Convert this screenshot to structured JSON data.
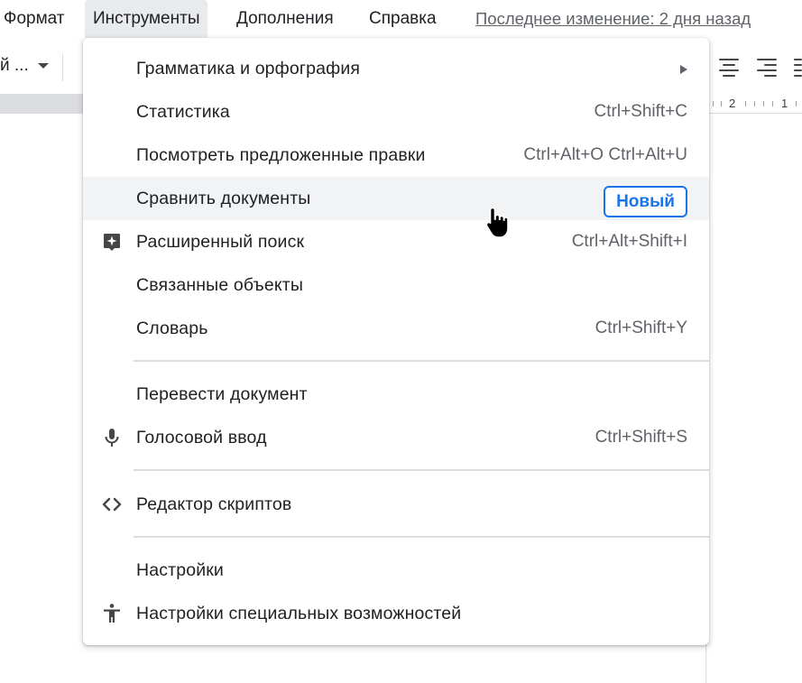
{
  "menubar": {
    "items": [
      {
        "label": "Формат"
      },
      {
        "label": "Инструменты",
        "active": true
      },
      {
        "label": "Дополнения"
      },
      {
        "label": "Справка"
      }
    ],
    "last_edit": "Последнее изменение: 2 дня назад"
  },
  "toolbar": {
    "font_fragment": "й ...",
    "icons": [
      "dropdown-caret",
      "align-center-icon",
      "align-right-icon",
      "align-justify-icon"
    ]
  },
  "ruler": {
    "numbers": [
      "2",
      "1"
    ]
  },
  "tools_menu": {
    "items": [
      {
        "label": "Грамматика и орфография",
        "submenu": true
      },
      {
        "label": "Статистика",
        "shortcut": "Ctrl+Shift+C"
      },
      {
        "label": "Посмотреть предложенные правки",
        "shortcut": "Ctrl+Alt+O Ctrl+Alt+U"
      },
      {
        "label": "Сравнить документы",
        "badge": "Новый",
        "hovered": true
      },
      {
        "label": "Расширенный поиск",
        "shortcut": "Ctrl+Alt+Shift+I",
        "icon": "sparkle-search-icon"
      },
      {
        "label": "Связанные объекты"
      },
      {
        "label": "Словарь",
        "shortcut": "Ctrl+Shift+Y"
      },
      {
        "label": "Перевести документ"
      },
      {
        "label": "Голосовой ввод",
        "shortcut": "Ctrl+Shift+S",
        "icon": "microphone-icon"
      },
      {
        "label": "Редактор скриптов",
        "icon": "code-icon"
      },
      {
        "label": "Настройки"
      },
      {
        "label": "Настройки специальных возможностей",
        "icon": "accessibility-icon"
      }
    ]
  },
  "colors": {
    "accent": "#1a73e8",
    "text": "#202124",
    "secondary_text": "#5f6368",
    "hover": "#f1f3f4",
    "active_menu": "#e8eaed",
    "divider": "#dadce0"
  }
}
